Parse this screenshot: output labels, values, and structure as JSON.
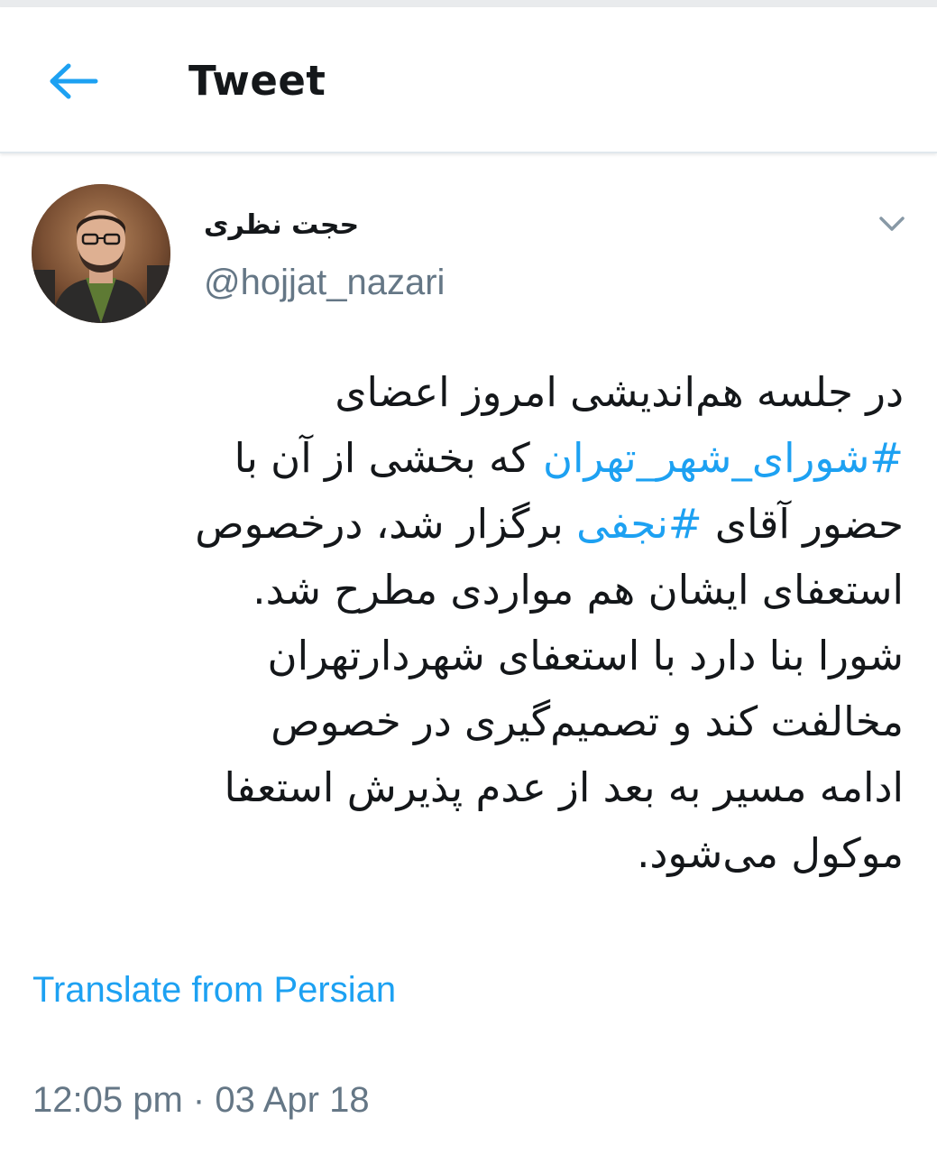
{
  "header": {
    "title": "Tweet",
    "back_icon": "arrow-left-icon",
    "accent_color": "#1da1f2"
  },
  "author": {
    "name": "حجت نظری",
    "handle": "@hojjat_nazari",
    "avatar_icon": "profile-photo"
  },
  "tweet": {
    "lines": [
      [
        {
          "text": "در جلسه هم‌اندیشی امروز اعضای",
          "hashtag": false
        }
      ],
      [
        {
          "text": "#شورای_شهر_تهران",
          "hashtag": true
        },
        {
          "text": " که بخشی از آن با",
          "hashtag": false
        }
      ],
      [
        {
          "text": "حضور آقای ",
          "hashtag": false
        },
        {
          "text": "#نجفی",
          "hashtag": true
        },
        {
          "text": " برگزار شد، درخصوص",
          "hashtag": false
        }
      ],
      [
        {
          "text": "استعفای ایشان هم مواردی مطرح شد.",
          "hashtag": false
        }
      ],
      [
        {
          "text": "شورا بنا دارد با استعفای شهردارتهران",
          "hashtag": false
        }
      ],
      [
        {
          "text": "مخالفت کند و تصمیم‌گیری در خصوص",
          "hashtag": false
        }
      ],
      [
        {
          "text": "ادامه مسیر به بعد از عدم پذیرش استعفا",
          "hashtag": false
        }
      ],
      [
        {
          "text": "موکول می‌شود.",
          "hashtag": false
        }
      ]
    ],
    "translate_label": "Translate from Persian",
    "timestamp": "12:05 pm · 03 Apr 18",
    "menu_icon": "chevron-down-icon"
  }
}
